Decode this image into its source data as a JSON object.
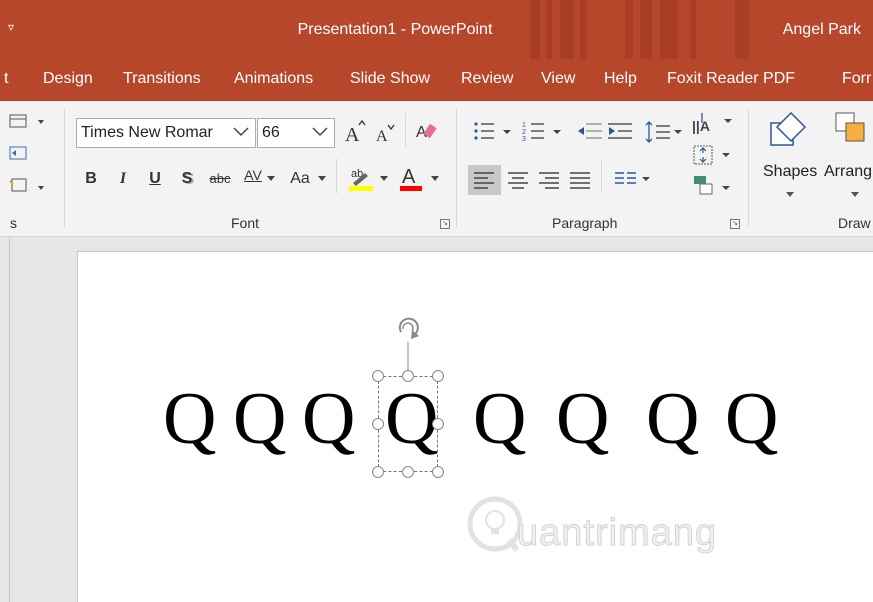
{
  "window": {
    "title": "Presentation1  -  PowerPoint",
    "user": "Angel Park"
  },
  "tabs": [
    {
      "label": "t"
    },
    {
      "label": "Design"
    },
    {
      "label": "Transitions"
    },
    {
      "label": "Animations"
    },
    {
      "label": "Slide Show"
    },
    {
      "label": "Review"
    },
    {
      "label": "View"
    },
    {
      "label": "Help"
    },
    {
      "label": "Foxit Reader PDF"
    },
    {
      "label": "Forr"
    }
  ],
  "ribbon": {
    "slides_group_label": "s",
    "font": {
      "group_label": "Font",
      "font_name": "Times New Romar",
      "font_size": "66",
      "bold": "B",
      "italic": "I",
      "underline": "U",
      "shadow": "S",
      "strikethrough": "abc",
      "char_spacing": "AV",
      "change_case": "Aa"
    },
    "paragraph": {
      "group_label": "Paragraph"
    },
    "drawing": {
      "group_label": "Draw",
      "shapes_label": "Shapes",
      "arrange_label": "Arrang"
    }
  },
  "slide": {
    "letters": [
      "Q",
      "Q",
      "Q",
      "Q",
      "Q",
      "Q",
      "Q",
      "Q"
    ],
    "watermark": "uantrimang"
  },
  "colors": {
    "accent": "#b7472a",
    "ribbon_bg": "#f3f3f3",
    "highlight": "#ffff00",
    "font_color": "#ff0000"
  }
}
